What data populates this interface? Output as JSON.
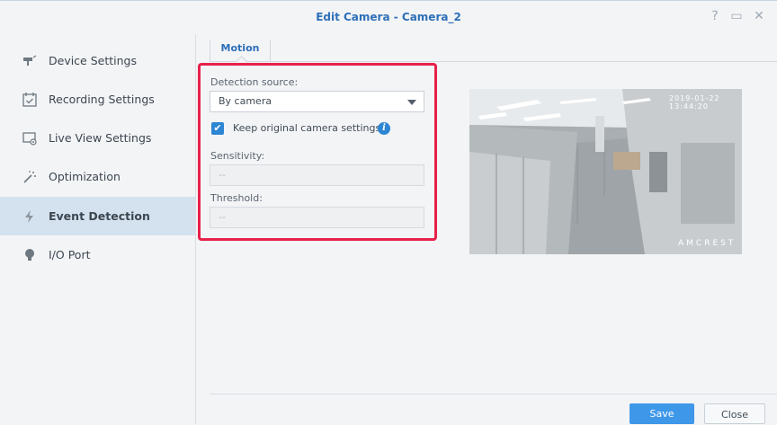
{
  "window": {
    "title": "Edit Camera - Camera_2",
    "help_glyph": "?",
    "minimize_glyph": "▭",
    "close_glyph": "✕"
  },
  "sidebar": {
    "items": [
      {
        "label": "Device Settings",
        "icon": "camera-mount-icon",
        "active": false
      },
      {
        "label": "Recording Settings",
        "icon": "calendar-check-icon",
        "active": false
      },
      {
        "label": "Live View Settings",
        "icon": "monitor-icon",
        "active": false
      },
      {
        "label": "Optimization",
        "icon": "magic-wand-icon",
        "active": false
      },
      {
        "label": "Event Detection",
        "icon": "lightning-icon",
        "active": true
      },
      {
        "label": "I/O Port",
        "icon": "bulb-icon",
        "active": false
      }
    ]
  },
  "tabs": [
    {
      "label": "Motion",
      "active": true
    }
  ],
  "form": {
    "detection_source_label": "Detection source:",
    "detection_source_value": "By camera",
    "keep_settings_label": "Keep original camera settings",
    "keep_settings_checked": true,
    "sensitivity_label": "Sensitivity:",
    "sensitivity_value": "--",
    "threshold_label": "Threshold:",
    "threshold_value": "--"
  },
  "preview": {
    "timestamp": "2019-01-22 13:44:20",
    "watermark": "AMCREST"
  },
  "footer": {
    "save_label": "Save",
    "close_label": "Close"
  },
  "colors": {
    "accent": "#2d6fb8",
    "highlight": "#e8204a",
    "primary_button": "#3e97e8",
    "active_nav": "#d4e2ef"
  }
}
